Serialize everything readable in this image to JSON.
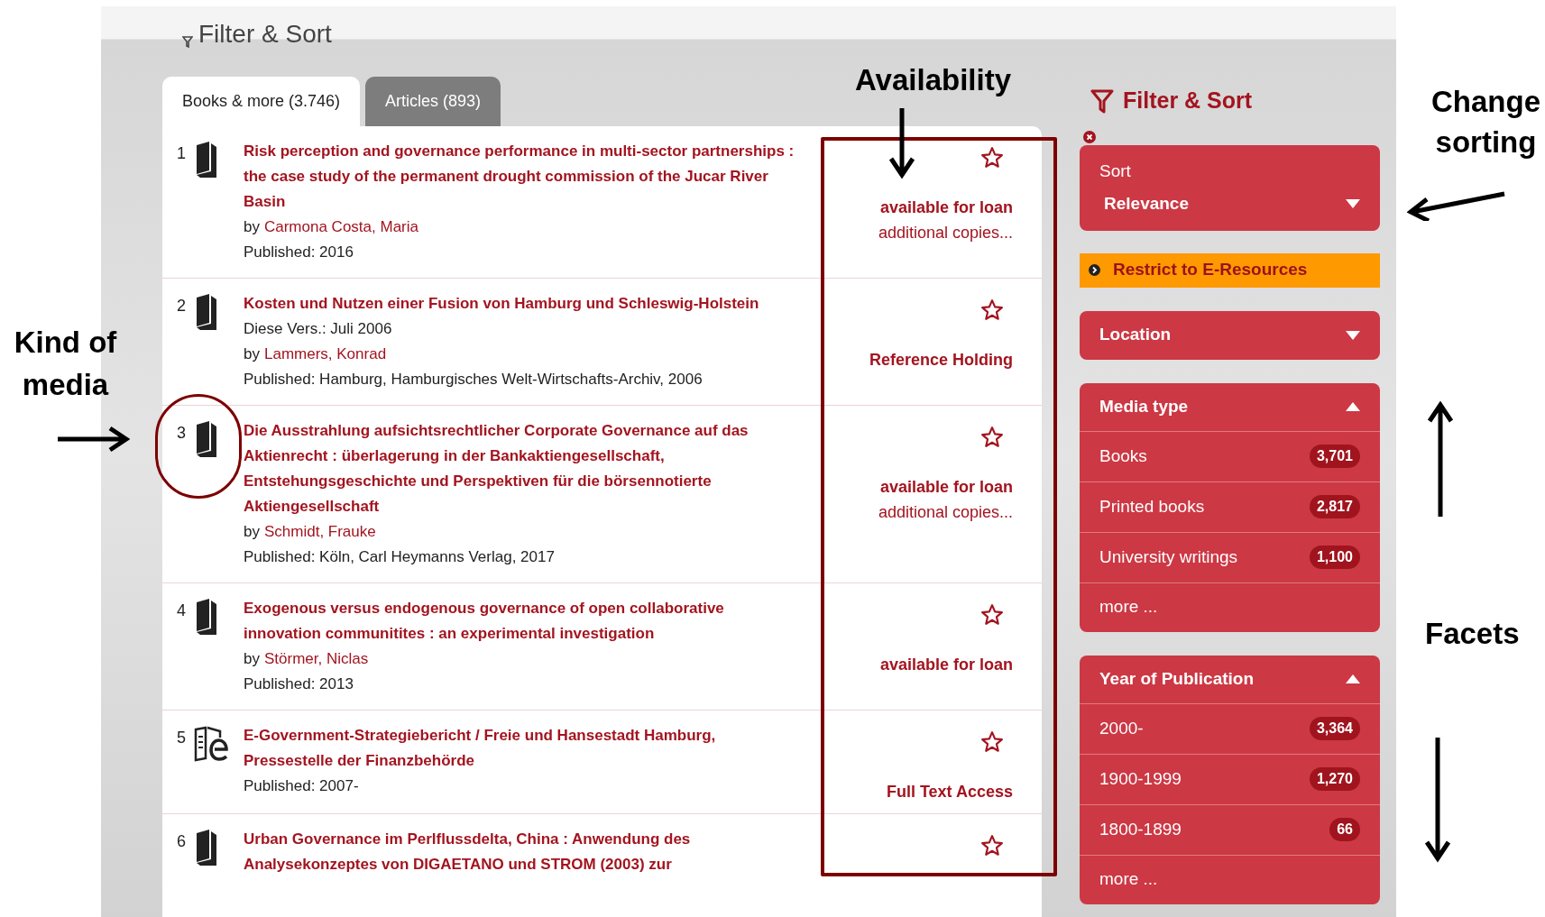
{
  "header": {
    "title": "Filter & Sort"
  },
  "tabs": [
    {
      "label": "Books & more (3.746)",
      "selected": true
    },
    {
      "label": "Articles (893)",
      "selected": false
    }
  ],
  "results": [
    {
      "number": "1",
      "kind": "book",
      "title": "Risk perception and governance performance in multi-sector partnerships : the case study of the permanent drought commission of the Jucar River Basin",
      "author": {
        "label": "by",
        "name": "Carmona Costa, Maria"
      },
      "published": "Published: 2016",
      "availability": {
        "status": "available for loan",
        "copies": "additional copies..."
      }
    },
    {
      "number": "2",
      "kind": "book",
      "title": "Kosten und Nutzen einer Fusion von Hamburg und Schleswig-Holstein",
      "edition": "Diese Vers.: Juli 2006",
      "author": {
        "label": "by",
        "name": "Lammers, Konrad"
      },
      "published": "Published: Hamburg, Hamburgisches Welt-Wirtschafts-Archiv, 2006",
      "availability": {
        "status": "Reference Holding"
      }
    },
    {
      "number": "3",
      "kind": "book",
      "title": "Die Ausstrahlung aufsichtsrechtlicher Corporate Governance auf das Aktienrecht : überlagerung in der Bankaktiengesellschaft, Entstehungsgeschichte und Perspektiven für die börsennotierte Aktiengesellschaft",
      "author": {
        "label": "by",
        "name": "Schmidt, Frauke"
      },
      "published": "Published: Köln, Carl Heymanns Verlag, 2017",
      "availability": {
        "status": "available for loan",
        "copies": "additional copies..."
      }
    },
    {
      "number": "4",
      "kind": "book",
      "title": "Exogenous versus endogenous governance of open collaborative innovation communitites : an experimental investigation",
      "author": {
        "label": "by",
        "name": "Störmer, Niclas"
      },
      "published": "Published: 2013",
      "availability": {
        "status": "available for loan"
      }
    },
    {
      "number": "5",
      "kind": "ebook",
      "title": "E-Government-Strategiebericht / Freie und Hansestadt Hamburg, Pressestelle der Finanzbehörde",
      "published": "Published: 2007-",
      "availability": {
        "status": "Full Text Access"
      }
    },
    {
      "number": "6",
      "kind": "book",
      "title": "Urban Governance im Perlflussdelta, China : Anwendung des Analysekonzeptes von DIGAETANO und STROM (2003) zur"
    }
  ],
  "sidebar": {
    "title": "Filter & Sort",
    "sort": {
      "label": "Sort",
      "value": "Relevance"
    },
    "restrict": "Restrict to E-Resources",
    "facets": [
      {
        "title": "Location",
        "expanded": false
      },
      {
        "title": "Media type",
        "expanded": true,
        "items": [
          {
            "label": "Books",
            "count": "3,701"
          },
          {
            "label": "Printed books",
            "count": "2,817"
          },
          {
            "label": "University writings",
            "count": "1,100"
          }
        ],
        "more": "more ..."
      },
      {
        "title": "Year of Publication",
        "expanded": true,
        "items": [
          {
            "label": "2000-",
            "count": "3,364"
          },
          {
            "label": "1900-1999",
            "count": "1,270"
          },
          {
            "label": "1800-1899",
            "count": "66"
          }
        ],
        "more": "more ..."
      }
    ]
  },
  "annotations": {
    "availability": "Availability",
    "kind_of_media": "Kind of media",
    "change_sorting": "Change sorting",
    "facets": "Facets"
  }
}
